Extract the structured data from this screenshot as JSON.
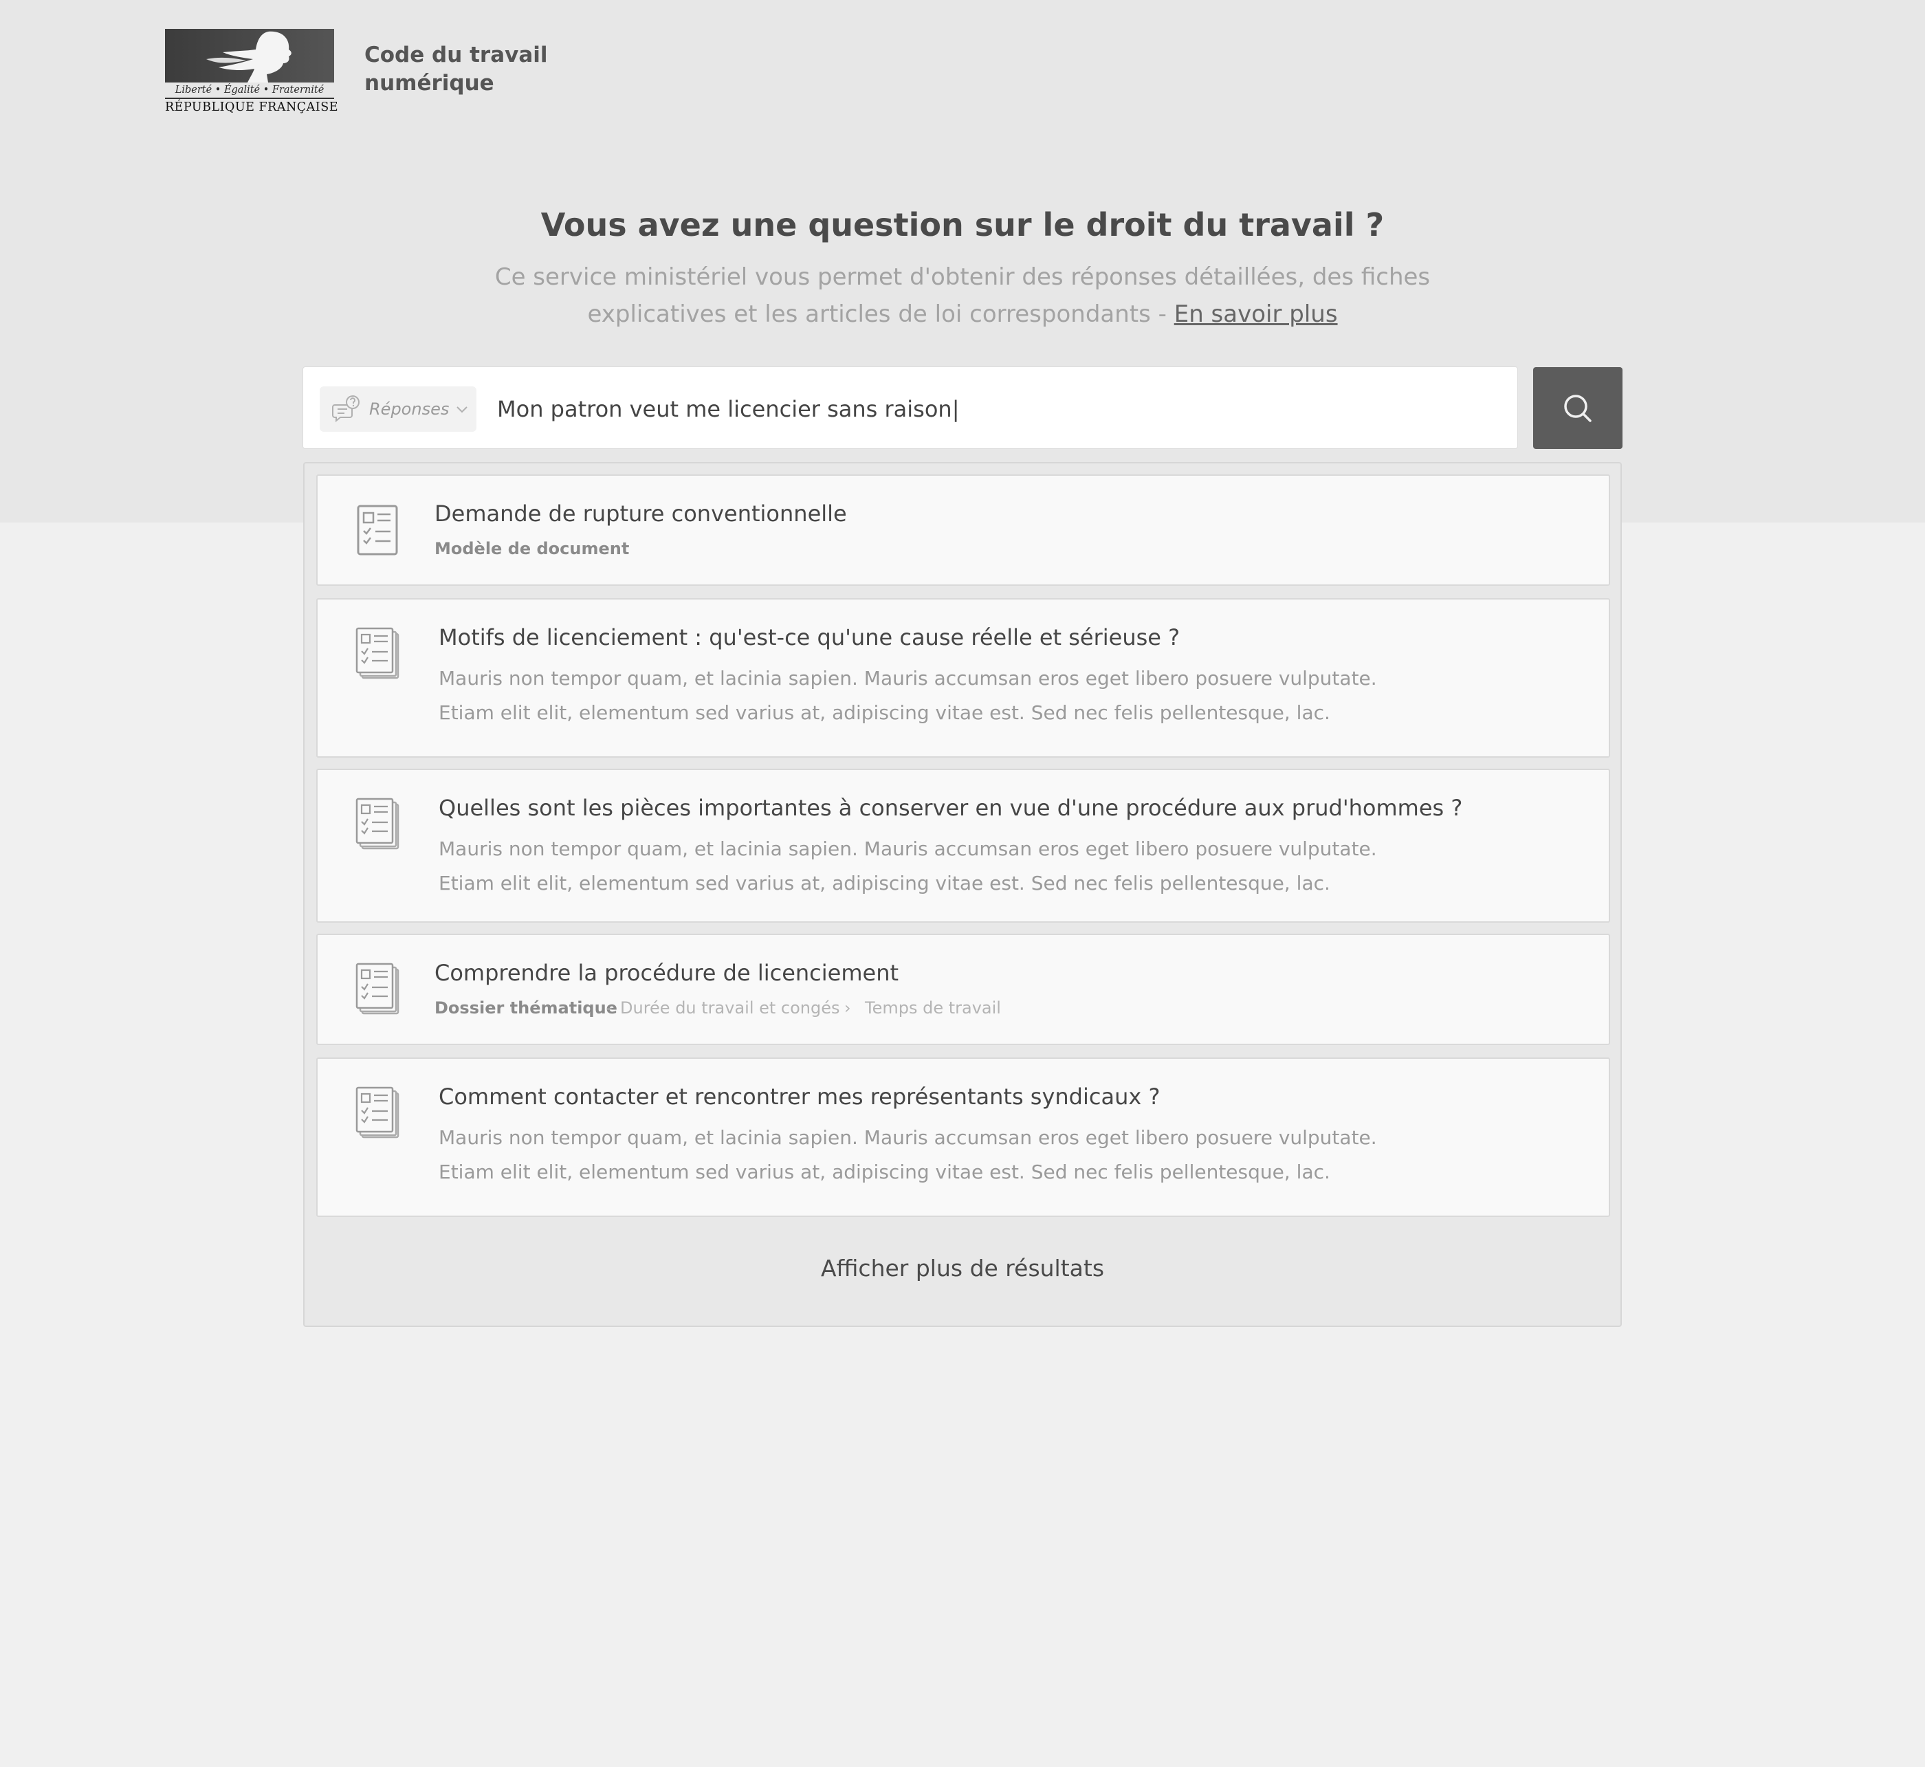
{
  "header": {
    "logo": {
      "motto": "Liberté • Égalité • Fraternité",
      "country": "RÉPUBLIQUE FRANÇAISE"
    },
    "site_title_line1": "Code du travail",
    "site_title_line2": "numérique"
  },
  "hero": {
    "headline": "Vous avez une question sur le droit du travail ?",
    "intro_line1": "Ce service ministériel vous permet d'obtenir des réponses détaillées, des fiches",
    "intro_line2": "explicatives et les articles de loi correspondants - ",
    "intro_link": "En savoir plus"
  },
  "search": {
    "filter_label": "Réponses",
    "query": "Mon patron veut me licencier sans raison|",
    "icons": {
      "filter": "chat-question-icon",
      "dropdown": "chevron-down-icon",
      "submit": "search-icon"
    }
  },
  "results": [
    {
      "title": "Demande de rupture conventionnelle",
      "type": "Modèle de document",
      "icon": "document-checklist-icon"
    },
    {
      "title": "Motifs de licenciement : qu'est-ce qu'une cause réelle et sérieuse ?",
      "desc": "Mauris non tempor quam, et lacinia sapien. Mauris accumsan eros eget libero posuere vulputate. Etiam elit elit, elementum sed varius at, adipiscing vitae est. Sed nec felis pellentesque, lac.",
      "icon": "stacked-documents-icon"
    },
    {
      "title": "Quelles sont les pièces importantes à conserver en vue d'une procédure aux prud'hommes ?",
      "desc": "Mauris non tempor quam, et lacinia sapien. Mauris accumsan eros eget libero posuere vulputate. Etiam elit elit, elementum sed varius at, adipiscing vitae est. Sed nec felis pellentesque, lac.",
      "icon": "stacked-documents-icon"
    },
    {
      "title": "Comprendre la procédure de licenciement",
      "type": "Dossier thématique",
      "breadcrumb_sep": "-",
      "breadcrumb_1": "Durée du travail et congés",
      "breadcrumb_arrow": "›",
      "breadcrumb_2": "Temps de travail",
      "icon": "stacked-documents-icon"
    },
    {
      "title": "Comment contacter et rencontrer mes représentants syndicaux ?",
      "desc": "Mauris non tempor quam, et lacinia sapien. Mauris accumsan eros eget libero posuere vulputate. Etiam elit elit, elementum sed varius at, adipiscing vitae est. Sed nec felis pellentesque, lac.",
      "icon": "stacked-documents-icon"
    }
  ],
  "more_results_label": "Afficher plus de résultats"
}
